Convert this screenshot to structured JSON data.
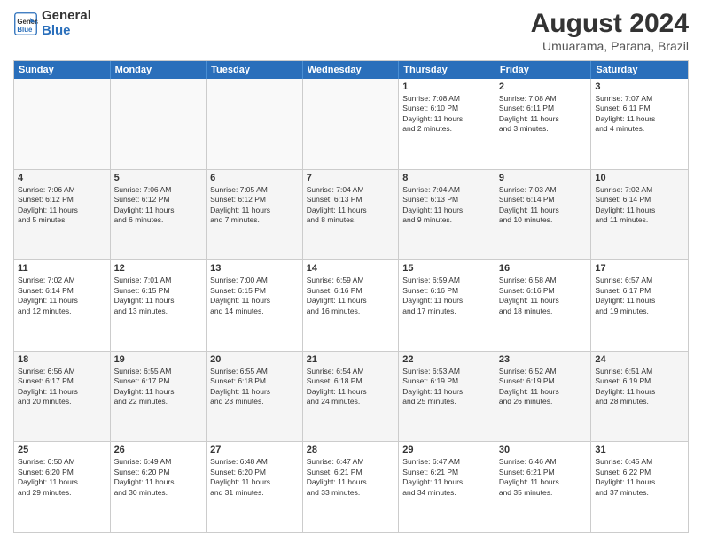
{
  "header": {
    "logo_line1": "General",
    "logo_line2": "Blue",
    "title": "August 2024",
    "subtitle": "Umuarama, Parana, Brazil"
  },
  "weekdays": [
    "Sunday",
    "Monday",
    "Tuesday",
    "Wednesday",
    "Thursday",
    "Friday",
    "Saturday"
  ],
  "rows": [
    [
      {
        "day": "",
        "text": ""
      },
      {
        "day": "",
        "text": ""
      },
      {
        "day": "",
        "text": ""
      },
      {
        "day": "",
        "text": ""
      },
      {
        "day": "1",
        "text": "Sunrise: 7:08 AM\nSunset: 6:10 PM\nDaylight: 11 hours\nand 2 minutes."
      },
      {
        "day": "2",
        "text": "Sunrise: 7:08 AM\nSunset: 6:11 PM\nDaylight: 11 hours\nand 3 minutes."
      },
      {
        "day": "3",
        "text": "Sunrise: 7:07 AM\nSunset: 6:11 PM\nDaylight: 11 hours\nand 4 minutes."
      }
    ],
    [
      {
        "day": "4",
        "text": "Sunrise: 7:06 AM\nSunset: 6:12 PM\nDaylight: 11 hours\nand 5 minutes."
      },
      {
        "day": "5",
        "text": "Sunrise: 7:06 AM\nSunset: 6:12 PM\nDaylight: 11 hours\nand 6 minutes."
      },
      {
        "day": "6",
        "text": "Sunrise: 7:05 AM\nSunset: 6:12 PM\nDaylight: 11 hours\nand 7 minutes."
      },
      {
        "day": "7",
        "text": "Sunrise: 7:04 AM\nSunset: 6:13 PM\nDaylight: 11 hours\nand 8 minutes."
      },
      {
        "day": "8",
        "text": "Sunrise: 7:04 AM\nSunset: 6:13 PM\nDaylight: 11 hours\nand 9 minutes."
      },
      {
        "day": "9",
        "text": "Sunrise: 7:03 AM\nSunset: 6:14 PM\nDaylight: 11 hours\nand 10 minutes."
      },
      {
        "day": "10",
        "text": "Sunrise: 7:02 AM\nSunset: 6:14 PM\nDaylight: 11 hours\nand 11 minutes."
      }
    ],
    [
      {
        "day": "11",
        "text": "Sunrise: 7:02 AM\nSunset: 6:14 PM\nDaylight: 11 hours\nand 12 minutes."
      },
      {
        "day": "12",
        "text": "Sunrise: 7:01 AM\nSunset: 6:15 PM\nDaylight: 11 hours\nand 13 minutes."
      },
      {
        "day": "13",
        "text": "Sunrise: 7:00 AM\nSunset: 6:15 PM\nDaylight: 11 hours\nand 14 minutes."
      },
      {
        "day": "14",
        "text": "Sunrise: 6:59 AM\nSunset: 6:16 PM\nDaylight: 11 hours\nand 16 minutes."
      },
      {
        "day": "15",
        "text": "Sunrise: 6:59 AM\nSunset: 6:16 PM\nDaylight: 11 hours\nand 17 minutes."
      },
      {
        "day": "16",
        "text": "Sunrise: 6:58 AM\nSunset: 6:16 PM\nDaylight: 11 hours\nand 18 minutes."
      },
      {
        "day": "17",
        "text": "Sunrise: 6:57 AM\nSunset: 6:17 PM\nDaylight: 11 hours\nand 19 minutes."
      }
    ],
    [
      {
        "day": "18",
        "text": "Sunrise: 6:56 AM\nSunset: 6:17 PM\nDaylight: 11 hours\nand 20 minutes."
      },
      {
        "day": "19",
        "text": "Sunrise: 6:55 AM\nSunset: 6:17 PM\nDaylight: 11 hours\nand 22 minutes."
      },
      {
        "day": "20",
        "text": "Sunrise: 6:55 AM\nSunset: 6:18 PM\nDaylight: 11 hours\nand 23 minutes."
      },
      {
        "day": "21",
        "text": "Sunrise: 6:54 AM\nSunset: 6:18 PM\nDaylight: 11 hours\nand 24 minutes."
      },
      {
        "day": "22",
        "text": "Sunrise: 6:53 AM\nSunset: 6:19 PM\nDaylight: 11 hours\nand 25 minutes."
      },
      {
        "day": "23",
        "text": "Sunrise: 6:52 AM\nSunset: 6:19 PM\nDaylight: 11 hours\nand 26 minutes."
      },
      {
        "day": "24",
        "text": "Sunrise: 6:51 AM\nSunset: 6:19 PM\nDaylight: 11 hours\nand 28 minutes."
      }
    ],
    [
      {
        "day": "25",
        "text": "Sunrise: 6:50 AM\nSunset: 6:20 PM\nDaylight: 11 hours\nand 29 minutes."
      },
      {
        "day": "26",
        "text": "Sunrise: 6:49 AM\nSunset: 6:20 PM\nDaylight: 11 hours\nand 30 minutes."
      },
      {
        "day": "27",
        "text": "Sunrise: 6:48 AM\nSunset: 6:20 PM\nDaylight: 11 hours\nand 31 minutes."
      },
      {
        "day": "28",
        "text": "Sunrise: 6:47 AM\nSunset: 6:21 PM\nDaylight: 11 hours\nand 33 minutes."
      },
      {
        "day": "29",
        "text": "Sunrise: 6:47 AM\nSunset: 6:21 PM\nDaylight: 11 hours\nand 34 minutes."
      },
      {
        "day": "30",
        "text": "Sunrise: 6:46 AM\nSunset: 6:21 PM\nDaylight: 11 hours\nand 35 minutes."
      },
      {
        "day": "31",
        "text": "Sunrise: 6:45 AM\nSunset: 6:22 PM\nDaylight: 11 hours\nand 37 minutes."
      }
    ]
  ]
}
